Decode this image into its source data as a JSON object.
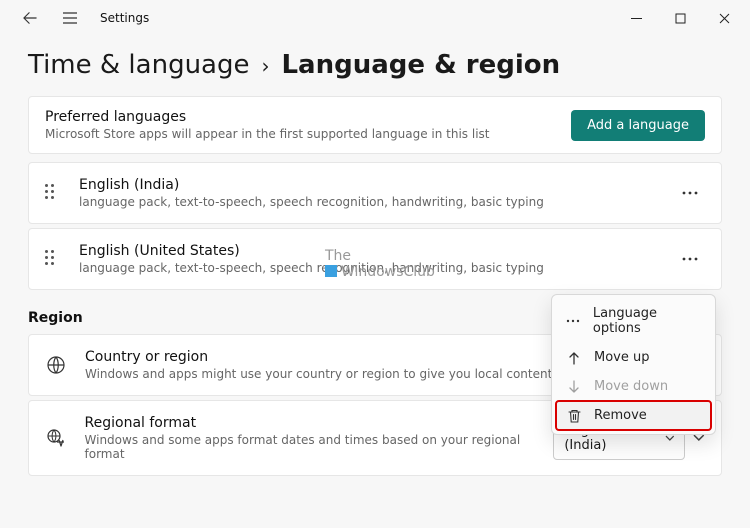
{
  "titlebar": {
    "app_title": "Settings"
  },
  "breadcrumb": {
    "parent": "Time & language",
    "sep": "›",
    "current": "Language & region"
  },
  "preferred": {
    "heading": "Preferred languages",
    "sub": "Microsoft Store apps will appear in the first supported language in this list",
    "add_button": "Add a language"
  },
  "languages": [
    {
      "name": "English (India)",
      "features": "language pack, text-to-speech, speech recognition, handwriting, basic typing"
    },
    {
      "name": "English (United States)",
      "features": "language pack, text-to-speech, speech recognition, handwriting, basic typing"
    }
  ],
  "region": {
    "heading": "Region",
    "country": {
      "title": "Country or region",
      "sub": "Windows and apps might use your country or region to give you local content"
    },
    "format": {
      "title": "Regional format",
      "sub": "Windows and some apps format dates and times based on your regional format",
      "value": "English (India)"
    }
  },
  "context_menu": {
    "options": "Language options",
    "move_up": "Move up",
    "move_down": "Move down",
    "remove": "Remove"
  },
  "watermark": {
    "line1": "The",
    "line2": "WindowsClub"
  }
}
